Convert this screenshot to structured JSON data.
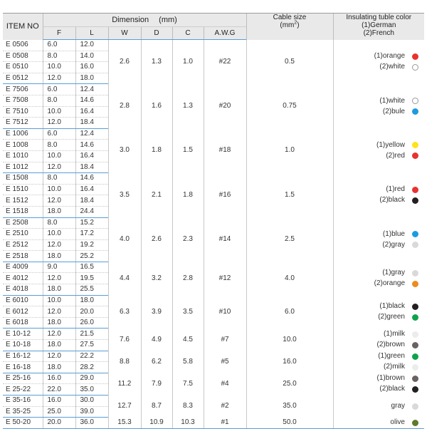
{
  "headers": {
    "item": "ITEM NO",
    "dimension": "Dimension",
    "unit": "(mm)",
    "f": "F",
    "l": "L",
    "w": "W",
    "d": "D",
    "c": "C",
    "awg": "A.W.G",
    "cable_line": "Cable size",
    "cable_unit": "(mm",
    "cable_unit_sup": "2",
    "cable_unit_close": ")",
    "color_line1": "Insulating tuble color",
    "color_line2": "(1)German",
    "color_line3": "(2)French"
  },
  "groups": [
    {
      "w": "2.6",
      "d": "1.3",
      "c": "1.0",
      "awg": "#22",
      "cable": "0.5",
      "rows": [
        [
          "E 0506",
          "6.0",
          "12.0"
        ],
        [
          "E 0508",
          "8.0",
          "14.0"
        ],
        [
          "E 0510",
          "10.0",
          "16.0"
        ],
        [
          "E 0512",
          "12.0",
          "18.0"
        ]
      ],
      "colors": [
        {
          "label": "(1)orange",
          "hex": "#e8322e"
        },
        {
          "label": "(2)white",
          "hex": "#ffffff",
          "outline": true
        }
      ]
    },
    {
      "w": "2.8",
      "d": "1.6",
      "c": "1.3",
      "awg": "#20",
      "cable": "0.75",
      "rows": [
        [
          "E 7506",
          "6.0",
          "12.4"
        ],
        [
          "E 7508",
          "8.0",
          "14.6"
        ],
        [
          "E 7510",
          "10.0",
          "16.4"
        ],
        [
          "E 7512",
          "12.0",
          "18.4"
        ]
      ],
      "colors": [
        {
          "label": "(1)white",
          "hex": "#ffffff",
          "outline": true
        },
        {
          "label": "(2)bule",
          "hex": "#1e9be0"
        }
      ]
    },
    {
      "w": "3.0",
      "d": "1.8",
      "c": "1.5",
      "awg": "#18",
      "cable": "1.0",
      "rows": [
        [
          "E 1006",
          "6.0",
          "12.4"
        ],
        [
          "E 1008",
          "8.0",
          "14.6"
        ],
        [
          "E 1010",
          "10.0",
          "16.4"
        ],
        [
          "E 1012",
          "12.0",
          "18.4"
        ]
      ],
      "colors": [
        {
          "label": "(1)yellow",
          "hex": "#ffe21a"
        },
        {
          "label": "(2)red",
          "hex": "#e8322e"
        }
      ]
    },
    {
      "w": "3.5",
      "d": "2.1",
      "c": "1.8",
      "awg": "#16",
      "cable": "1.5",
      "rows": [
        [
          "E 1508",
          "8.0",
          "14.6"
        ],
        [
          "E 1510",
          "10.0",
          "16.4"
        ],
        [
          "E 1512",
          "12.0",
          "18.4"
        ],
        [
          "E 1518",
          "18.0",
          "24.4"
        ]
      ],
      "colors": [
        {
          "label": "(1)red",
          "hex": "#e8322e"
        },
        {
          "label": "(2)black",
          "hex": "#231f20"
        }
      ]
    },
    {
      "w": "4.0",
      "d": "2.6",
      "c": "2.3",
      "awg": "#14",
      "cable": "2.5",
      "rows": [
        [
          "E 2508",
          "8.0",
          "15.2"
        ],
        [
          "E 2510",
          "10.0",
          "17.2"
        ],
        [
          "E 2512",
          "12.0",
          "19.2"
        ],
        [
          "E 2518",
          "18.0",
          "25.2"
        ]
      ],
      "colors": [
        {
          "label": "(1)blue",
          "hex": "#1e9be0"
        },
        {
          "label": "(2)gray",
          "hex": "#d9d9d9"
        }
      ]
    },
    {
      "w": "4.4",
      "d": "3.2",
      "c": "2.8",
      "awg": "#12",
      "cable": "4.0",
      "rows": [
        [
          "E 4009",
          "9.0",
          "16.5"
        ],
        [
          "E 4012",
          "12.0",
          "19.5"
        ],
        [
          "E 4018",
          "18.0",
          "25.5"
        ]
      ],
      "colors": [
        {
          "label": "(1)gray",
          "hex": "#d9d9d9"
        },
        {
          "label": "(2)orange",
          "hex": "#ee8a1f"
        }
      ]
    },
    {
      "w": "6.3",
      "d": "3.9",
      "c": "3.5",
      "awg": "#10",
      "cable": "6.0",
      "rows": [
        [
          "E 6010",
          "10.0",
          "18.0"
        ],
        [
          "E 6012",
          "12.0",
          "20.0"
        ],
        [
          "E 6018",
          "18.0",
          "26.0"
        ]
      ],
      "colors": [
        {
          "label": "(1)black",
          "hex": "#231f20"
        },
        {
          "label": "(2)green",
          "hex": "#10a24a"
        }
      ]
    },
    {
      "w": "7.6",
      "d": "4.9",
      "c": "4.5",
      "awg": "#7",
      "cable": "10.0",
      "rows": [
        [
          "E 10-12",
          "12.0",
          "21.5"
        ],
        [
          "E 10-18",
          "18.0",
          "27.5"
        ]
      ],
      "colors": [
        {
          "label": "(1)milk",
          "hex": "#ececec"
        },
        {
          "label": "(2)brown",
          "hex": "#6b6161"
        }
      ]
    },
    {
      "w": "8.8",
      "d": "6.2",
      "c": "5.8",
      "awg": "#5",
      "cable": "16.0",
      "rows": [
        [
          "E 16-12",
          "12.0",
          "22.2"
        ],
        [
          "E 16-18",
          "18.0",
          "28.2"
        ]
      ],
      "colors": [
        {
          "label": "(1)green",
          "hex": "#10a24a"
        },
        {
          "label": "(2)milk",
          "hex": "#ececec"
        }
      ]
    },
    {
      "w": "11.2",
      "d": "7.9",
      "c": "7.5",
      "awg": "#4",
      "cable": "25.0",
      "rows": [
        [
          "E 25-16",
          "16.0",
          "29.0"
        ],
        [
          "E 25-22",
          "22.0",
          "35.0"
        ]
      ],
      "colors": [
        {
          "label": "(1)brown",
          "hex": "#6b6161"
        },
        {
          "label": "(2)black",
          "hex": "#231f20"
        }
      ]
    },
    {
      "w": "12.7",
      "d": "8.7",
      "c": "8.3",
      "awg": "#2",
      "cable": "35.0",
      "rows": [
        [
          "E 35-16",
          "16.0",
          "30.0"
        ],
        [
          "E 35-25",
          "25.0",
          "39.0"
        ]
      ],
      "colors": [
        {
          "label": "gray",
          "hex": "#d9d9d9"
        }
      ]
    },
    {
      "w": "15.3",
      "d": "10.9",
      "c": "10.3",
      "awg": "#1",
      "cable": "50.0",
      "rows": [
        [
          "E 50-20",
          "20.0",
          "36.0"
        ]
      ],
      "colors": [
        {
          "label": "olive",
          "hex": "#5e7a2c"
        }
      ]
    }
  ]
}
